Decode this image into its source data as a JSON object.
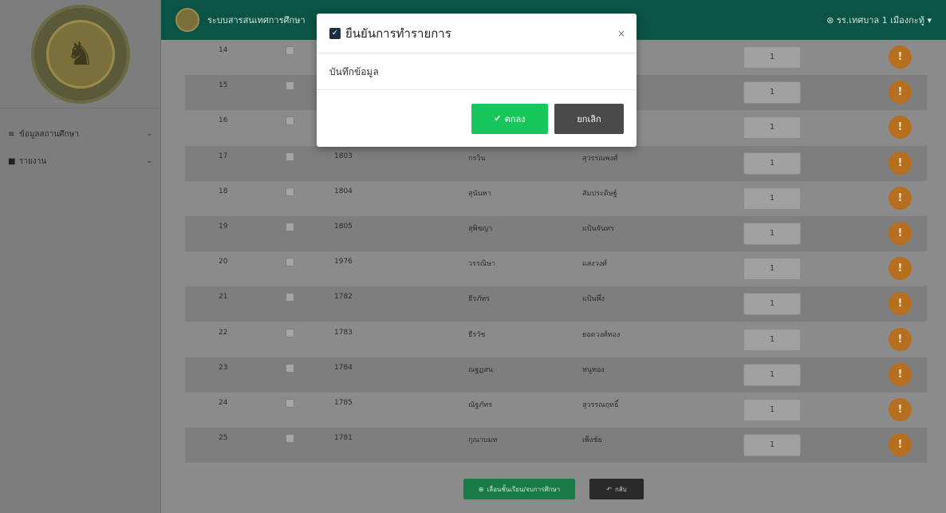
{
  "topbar": {
    "title": "ระบบสารสนเทศการศึกษา",
    "user": "รร.เทศบาล 1 เมืองกะทู้",
    "user_icon": "user-circle-icon",
    "caret": "▾"
  },
  "sidebar": {
    "items": [
      {
        "label": "ข้อมูลสถานศึกษา",
        "icon": "graduation-cap-icon",
        "glyph": "≡"
      },
      {
        "label": "รายงาน",
        "icon": "file-icon",
        "glyph": "■"
      }
    ]
  },
  "table": {
    "rows": [
      {
        "no": "14",
        "id": "",
        "first": "",
        "last": "",
        "qty": "1"
      },
      {
        "no": "15",
        "id": "",
        "first": "",
        "last": "",
        "qty": "1"
      },
      {
        "no": "16",
        "id": "",
        "first": "",
        "last": "",
        "qty": "1"
      },
      {
        "no": "17",
        "id": "1803",
        "first": "กรวิน",
        "last": "สุวรรณพงศ์",
        "qty": "1"
      },
      {
        "no": "18",
        "id": "1804",
        "first": "สุนันทา",
        "last": "สัมประดิษฐ์",
        "qty": "1"
      },
      {
        "no": "19",
        "id": "1805",
        "first": "สุพิชญา",
        "last": "แป้นจันทร",
        "qty": "1"
      },
      {
        "no": "20",
        "id": "1976",
        "first": "วรรณิษา",
        "last": "แสงวงศ์",
        "qty": "1"
      },
      {
        "no": "21",
        "id": "1782",
        "first": "ธีรภัทร",
        "last": "แป้นพึ่ง",
        "qty": "1"
      },
      {
        "no": "22",
        "id": "1783",
        "first": "ธีรวัช",
        "last": "ยอดวงศ์ทอง",
        "qty": "1"
      },
      {
        "no": "23",
        "id": "1784",
        "first": "ณฐฏสน",
        "last": "หนูทอง",
        "qty": "1"
      },
      {
        "no": "24",
        "id": "1785",
        "first": "ณัฐภัทร",
        "last": "สุวรรณฤทธิ์",
        "qty": "1"
      },
      {
        "no": "25",
        "id": "1781",
        "first": "กุณาบมท",
        "last": "เพ็งชัย",
        "qty": "1"
      }
    ],
    "more_icon": "exclamation-icon",
    "more_glyph": "!"
  },
  "footer": {
    "promote_label": "เลื่อนชั้นเรียน/จบการศึกษา",
    "back_label": "กลับ"
  },
  "modal": {
    "title": "ยืนยันการทำรายการ",
    "body": "บันทึกข้อมูล",
    "close": "×",
    "ok_label": "ตกลง",
    "cancel_label": "ยกเลิก"
  },
  "colors": {
    "topbar": "#0b5445",
    "ok_button": "#17c75c",
    "cancel_button": "#4a4a4a",
    "action_circle": "#b56f1e"
  }
}
